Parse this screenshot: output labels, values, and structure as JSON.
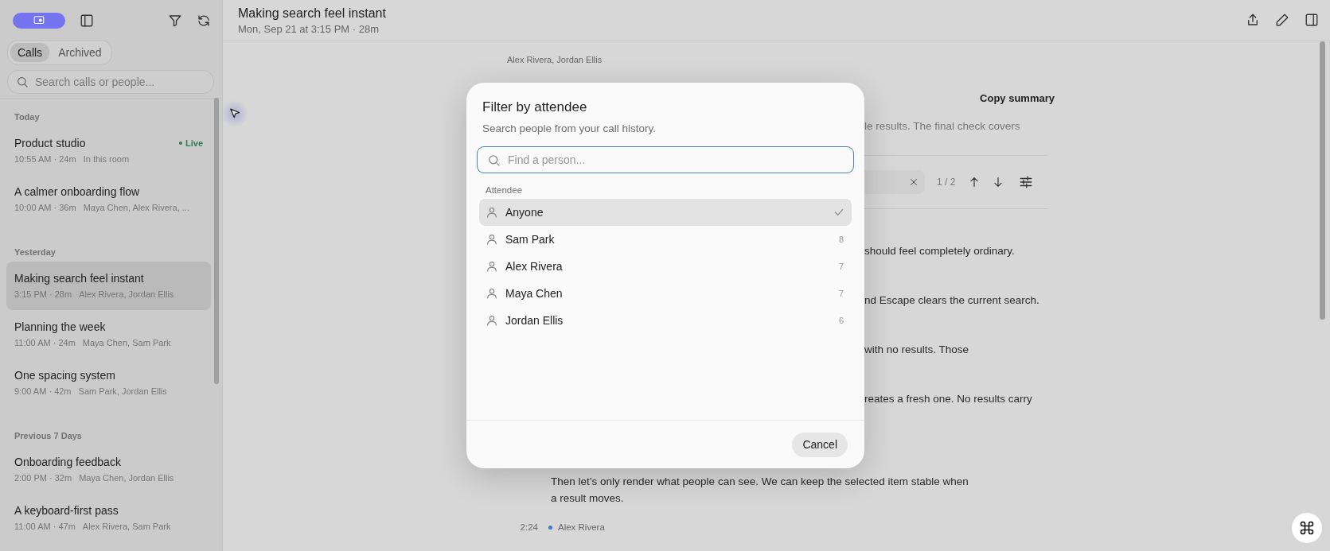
{
  "sidebar": {
    "tabs": [
      {
        "label": "Calls",
        "selected": true
      },
      {
        "label": "Archived",
        "selected": false
      }
    ],
    "search": {
      "placeholder": "Search calls or people..."
    },
    "groups": [
      {
        "heading": "Today",
        "calls": [
          {
            "title": "Product studio",
            "meta": "10:55 AM · 24m",
            "people": "In this room",
            "status": "Live",
            "selected": false
          },
          {
            "title": "A calmer onboarding flow",
            "meta": "10:00 AM · 36m",
            "people": "Maya Chen, Alex Rivera, ...",
            "selected": false
          }
        ]
      },
      {
        "heading": "Yesterday",
        "calls": [
          {
            "title": "Making search feel instant",
            "meta": "3:15 PM · 28m",
            "people": "Alex Rivera, Jordan Ellis",
            "selected": true
          },
          {
            "title": "Planning the week",
            "meta": "11:00 AM · 24m",
            "people": "Maya Chen, Sam Park",
            "selected": false
          },
          {
            "title": "One spacing system",
            "meta": "9:00 AM · 42m",
            "people": "Sam Park, Jordan Ellis",
            "selected": false
          }
        ]
      },
      {
        "heading": "Previous 7 Days",
        "calls": [
          {
            "title": "Onboarding feedback",
            "meta": "2:00 PM · 32m",
            "people": "Maya Chen, Jordan Ellis",
            "selected": false
          },
          {
            "title": "A keyboard-first pass",
            "meta": "11:00 AM · 47m",
            "people": "Alex Rivera, Sam Park",
            "selected": false
          }
        ]
      }
    ]
  },
  "header": {
    "title": "Making search feel instant",
    "subtitle": "Mon, Sep 21 at 3:15 PM · 28m"
  },
  "summary": {
    "attendees": "Alex Rivera, Jordan Ellis",
    "copy_button": "Copy summary",
    "text": "le results. The final check covers"
  },
  "find_bar": {
    "count": "1 / 2"
  },
  "transcript": [
    {
      "kind": "fragment",
      "text": "should feel completely ordinary."
    },
    {
      "kind": "fragment",
      "text": "nd Escape clears the current search."
    },
    {
      "kind": "fragment",
      "text": "with no results. Those"
    },
    {
      "kind": "fragment",
      "text": "reates a fresh one. No results carry"
    },
    {
      "kind": "message",
      "lines": [
        "Then let’s only render what people can see. We can keep the selected item stable when",
        "a result moves."
      ]
    },
    {
      "kind": "speaker",
      "time": "2:24",
      "name": "Alex Rivera"
    }
  ],
  "dialog": {
    "title": "Filter by attendee",
    "subtitle": "Search people from your call history.",
    "search": {
      "placeholder": "Find a person..."
    },
    "section": "Attendee",
    "people": [
      {
        "name": "Anyone",
        "selected": true
      },
      {
        "name": "Sam Park",
        "count": "8",
        "selected": false
      },
      {
        "name": "Alex Rivera",
        "count": "7",
        "selected": false
      },
      {
        "name": "Maya Chen",
        "count": "7",
        "selected": false
      },
      {
        "name": "Jordan Ellis",
        "count": "6",
        "selected": false
      }
    ],
    "cancel": "Cancel"
  }
}
